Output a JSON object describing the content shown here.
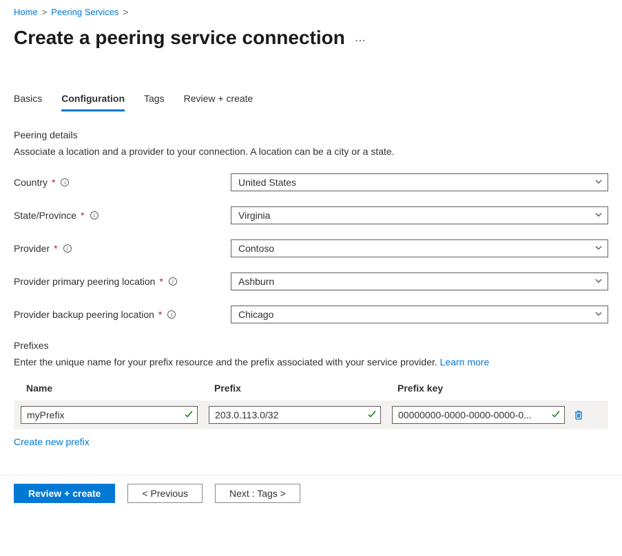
{
  "breadcrumb": {
    "items": [
      {
        "label": "Home"
      },
      {
        "label": "Peering Services"
      }
    ]
  },
  "page": {
    "title": "Create a peering service connection"
  },
  "tabs": [
    {
      "label": "Basics",
      "active": false
    },
    {
      "label": "Configuration",
      "active": true
    },
    {
      "label": "Tags",
      "active": false
    },
    {
      "label": "Review + create",
      "active": false
    }
  ],
  "peering_details": {
    "title": "Peering details",
    "description": "Associate a location and a provider to your connection. A location can be a city or a state.",
    "fields": {
      "country": {
        "label": "Country",
        "value": "United States",
        "required": true
      },
      "state": {
        "label": "State/Province",
        "value": "Virginia",
        "required": true
      },
      "provider": {
        "label": "Provider",
        "value": "Contoso",
        "required": true
      },
      "primary_location": {
        "label": "Provider primary peering location",
        "value": "Ashburn",
        "required": true
      },
      "backup_location": {
        "label": "Provider backup peering location",
        "value": "Chicago",
        "required": true
      }
    }
  },
  "prefixes": {
    "title": "Prefixes",
    "description": "Enter the unique name for your prefix resource and the prefix associated with your service provider. ",
    "learn_more": "Learn more",
    "columns": {
      "name": "Name",
      "prefix": "Prefix",
      "key": "Prefix key"
    },
    "row": {
      "name": "myPrefix",
      "prefix": "203.0.113.0/32",
      "key": "00000000-0000-0000-0000-0..."
    },
    "create_link": "Create new prefix"
  },
  "footer": {
    "review_create": "Review + create",
    "previous": "< Previous",
    "next": "Next : Tags >"
  }
}
